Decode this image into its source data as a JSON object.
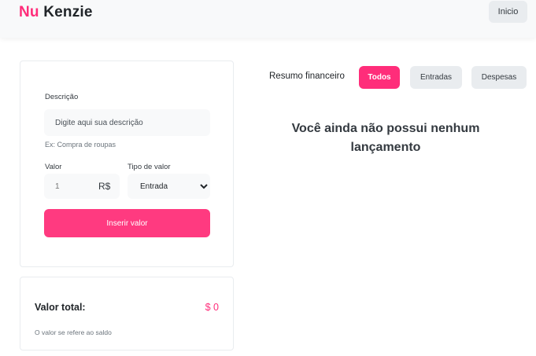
{
  "header": {
    "logo_nu": "Nu",
    "logo_kenzie": "Kenzie",
    "home_label": "Inicio"
  },
  "form": {
    "description_label": "Descrição",
    "description_placeholder": "Digite aqui sua descrição",
    "description_hint": "Ex: Compra de roupas",
    "value_label": "Valor",
    "value_placeholder": "1",
    "currency": "R$",
    "type_label": "Tipo de valor",
    "type_selected": "Entrada",
    "submit_label": "Inserir valor"
  },
  "total": {
    "label": "Valor total:",
    "value": "$ 0",
    "note": "O valor se refere ao saldo"
  },
  "summary": {
    "title": "Resumo financeiro",
    "filters": [
      {
        "label": "Todos",
        "active": true
      },
      {
        "label": "Entradas",
        "active": false
      },
      {
        "label": "Despesas",
        "active": false
      }
    ],
    "empty_message": "Você ainda não possui nenhum lançamento"
  },
  "colors": {
    "brand": "#ff2d7a",
    "muted_button": "#e9ecef",
    "input_bg": "#f8f9fa"
  }
}
